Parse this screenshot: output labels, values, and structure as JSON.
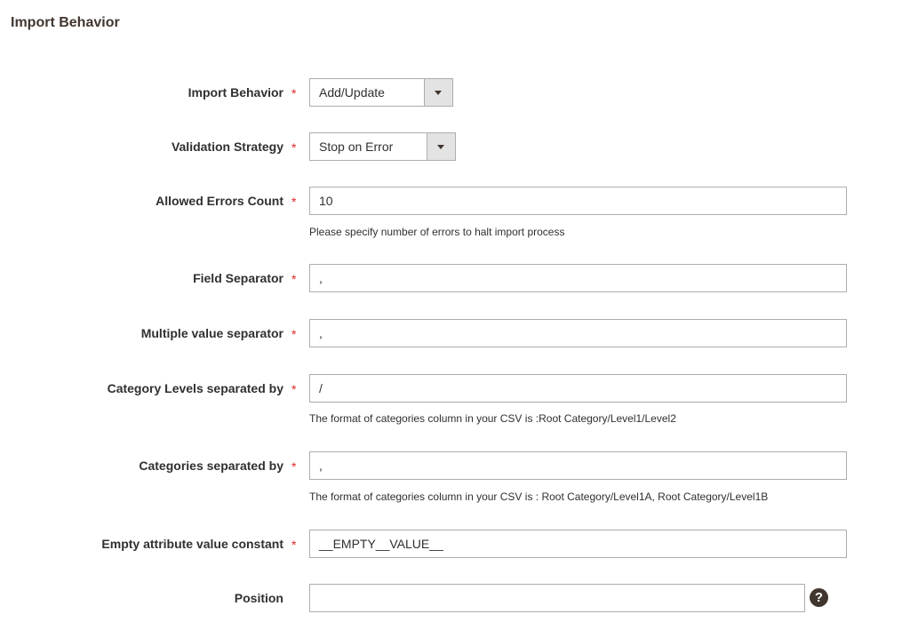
{
  "section": {
    "title": "Import Behavior"
  },
  "required_marker": "*",
  "fields": {
    "import_behavior": {
      "label": "Import Behavior",
      "value": "Add/Update"
    },
    "validation_strategy": {
      "label": "Validation Strategy",
      "value": "Stop on Error"
    },
    "allowed_errors": {
      "label": "Allowed Errors Count",
      "value": "10",
      "note": "Please specify number of errors to halt import process"
    },
    "field_separator": {
      "label": "Field Separator",
      "value": ","
    },
    "multiple_value_separator": {
      "label": "Multiple value separator",
      "value": ","
    },
    "category_levels": {
      "label": "Category Levels separated by",
      "value": "/",
      "note": "The format of categories column in your CSV is :Root Category/Level1/Level2"
    },
    "categories_separated": {
      "label": "Categories separated by",
      "value": ",",
      "note": "The format of categories column in your CSV is : Root Category/Level1A, Root Category/Level1B"
    },
    "empty_attribute": {
      "label": "Empty attribute value constant",
      "value": "__EMPTY__VALUE__"
    },
    "position": {
      "label": "Position",
      "value": ""
    }
  },
  "icons": {
    "help": "help-icon",
    "dropdown": "chevron-down-icon"
  },
  "help_glyph": "?",
  "colors": {
    "required": "#e22626",
    "title": "#41362f",
    "border": "#adadad",
    "select_button": "#e3e3e3"
  }
}
